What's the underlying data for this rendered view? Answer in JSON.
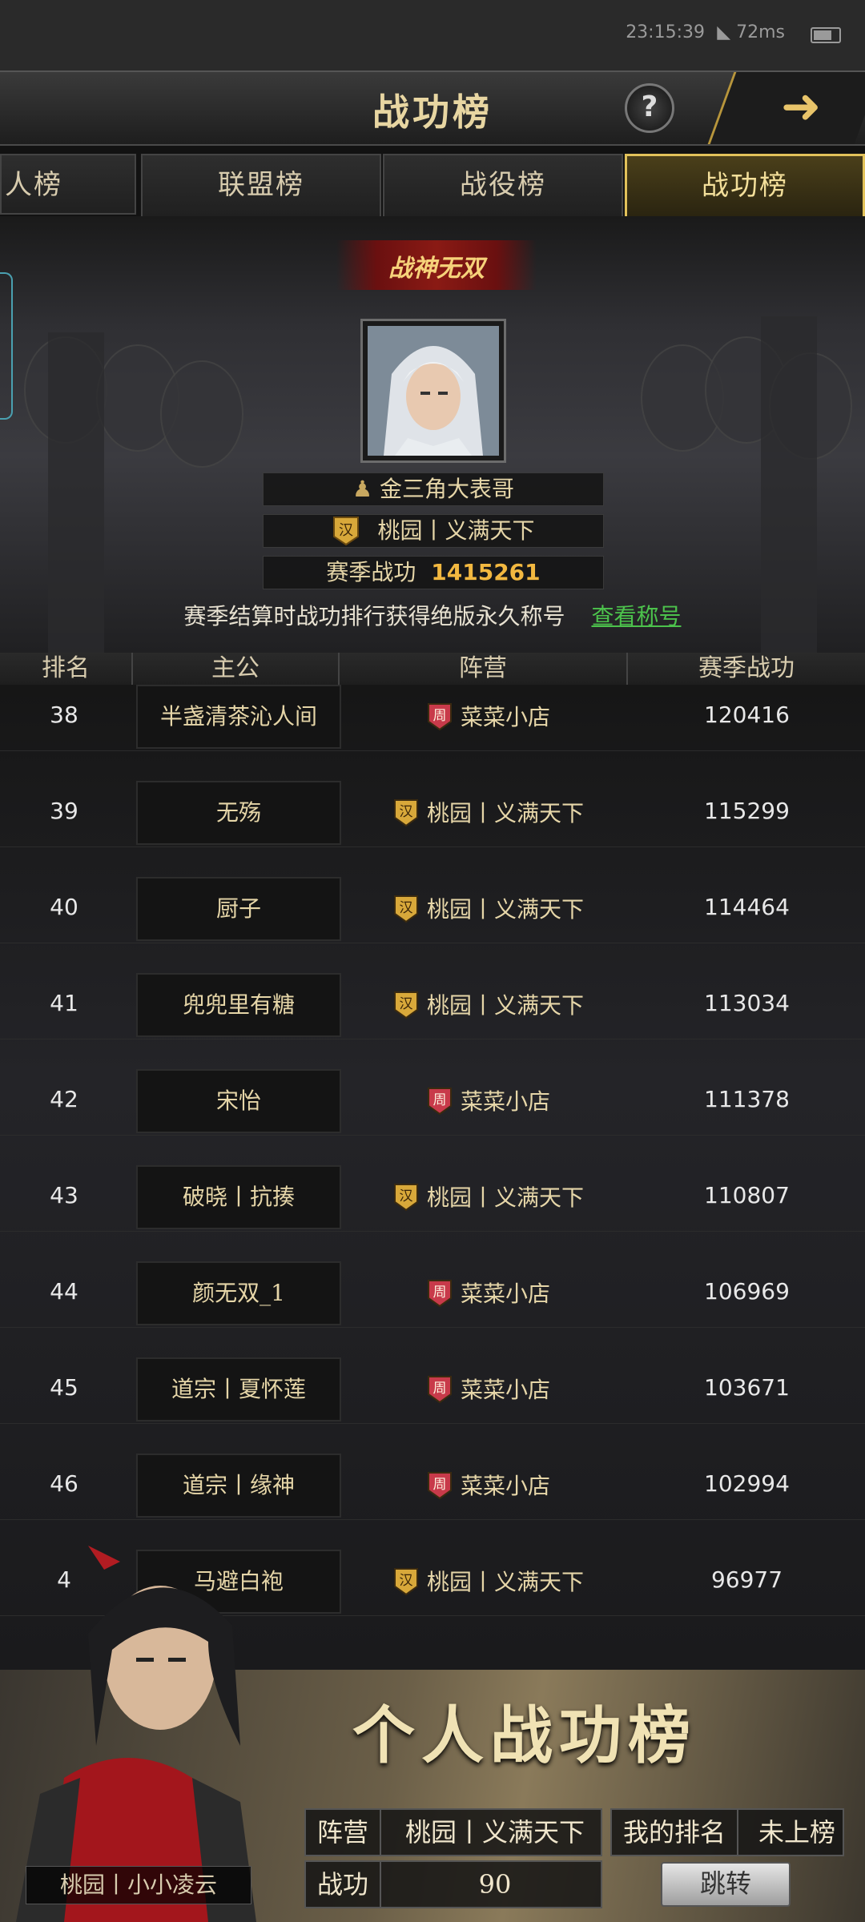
{
  "status_bar": {
    "time": "23:15:39",
    "ping": "72ms"
  },
  "header": {
    "title": "战功榜"
  },
  "tabs": [
    {
      "label": "人榜"
    },
    {
      "label": "联盟榜"
    },
    {
      "label": "战役榜"
    },
    {
      "label": "战功榜",
      "active": true
    }
  ],
  "champion": {
    "banner": "战神无双",
    "name": "金三角大表哥",
    "camp_badge": "汉",
    "camp": "桃园丨义满天下",
    "score_label": "赛季战功",
    "score": "1415261"
  },
  "notice": {
    "text": "赛季结算时战功排行获得绝版永久称号",
    "link": "查看称号"
  },
  "table": {
    "headers": [
      "排名",
      "主公",
      "阵营",
      "赛季战功"
    ],
    "rows": [
      {
        "rank": "38",
        "name": "半盏清茶沁人间",
        "badge": "周",
        "camp": "菜菜小店",
        "score": "120416"
      },
      {
        "rank": "39",
        "name": "无殇",
        "badge": "汉",
        "camp": "桃园丨义满天下",
        "score": "115299"
      },
      {
        "rank": "40",
        "name": "厨子",
        "badge": "汉",
        "camp": "桃园丨义满天下",
        "score": "114464"
      },
      {
        "rank": "41",
        "name": "兜兜里有糖",
        "badge": "汉",
        "camp": "桃园丨义满天下",
        "score": "113034"
      },
      {
        "rank": "42",
        "name": "宋怡",
        "badge": "周",
        "camp": "菜菜小店",
        "score": "111378"
      },
      {
        "rank": "43",
        "name": "破晓丨抗揍",
        "badge": "汉",
        "camp": "桃园丨义满天下",
        "score": "110807"
      },
      {
        "rank": "44",
        "name": "颜无双_1",
        "badge": "周",
        "camp": "菜菜小店",
        "score": "106969"
      },
      {
        "rank": "45",
        "name": "道宗丨夏怀莲",
        "badge": "周",
        "camp": "菜菜小店",
        "score": "103671"
      },
      {
        "rank": "46",
        "name": "道宗丨缘神",
        "badge": "周",
        "camp": "菜菜小店",
        "score": "102994"
      },
      {
        "rank": "4",
        "name": "马避白袍",
        "badge": "汉",
        "camp": "桃园丨义满天下",
        "score": "96977"
      }
    ]
  },
  "personal": {
    "title": "个人战功榜",
    "camp_label": "阵营",
    "camp": "桃园丨义满天下",
    "rank_label": "我的排名",
    "rank": "未上榜",
    "score_label": "战功",
    "score": "90",
    "jump": "跳转",
    "player": "桃园丨小小凌云"
  },
  "colors": {
    "accent_gold": "#e2c25a",
    "score_gold": "#f2b840",
    "link_green": "#4cc24c",
    "badge_han": "#d8a83a",
    "badge_zhou": "#c83a4a"
  }
}
